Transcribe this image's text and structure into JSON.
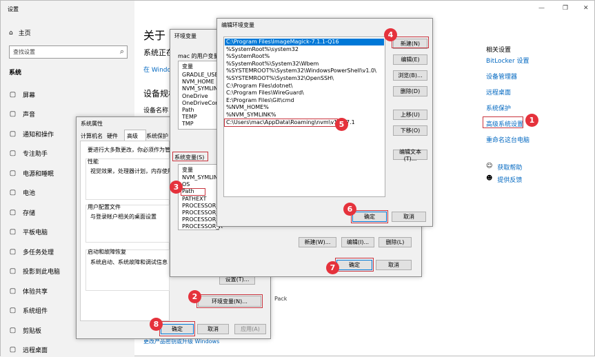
{
  "settings": {
    "title": "设置",
    "home": "主页",
    "search_placeholder": "查找设置",
    "section": "系统",
    "nav": [
      {
        "label": "屏幕",
        "icon": "monitor-icon"
      },
      {
        "label": "声音",
        "icon": "speaker-icon"
      },
      {
        "label": "通知和操作",
        "icon": "notification-icon"
      },
      {
        "label": "专注助手",
        "icon": "moon-icon"
      },
      {
        "label": "电源和睡眠",
        "icon": "power-icon"
      },
      {
        "label": "电池",
        "icon": "battery-icon"
      },
      {
        "label": "存储",
        "icon": "storage-icon"
      },
      {
        "label": "平板电脑",
        "icon": "tablet-icon"
      },
      {
        "label": "多任务处理",
        "icon": "multitask-icon"
      },
      {
        "label": "投影到此电脑",
        "icon": "project-icon"
      },
      {
        "label": "体验共享",
        "icon": "share-icon"
      },
      {
        "label": "系统组件",
        "icon": "components-icon"
      },
      {
        "label": "剪贴板",
        "icon": "clipboard-icon"
      },
      {
        "label": "远程桌面",
        "icon": "remote-icon"
      }
    ],
    "main_title": "关于",
    "main_sub1": "系统正在",
    "main_link1": "在 Window",
    "main_sub2": "设备规格",
    "main_sub3": "设备名称",
    "bottom_link": "更改产品密钥或升级 Windows",
    "pack_text": "Pack",
    "related_title": "相关设置",
    "related": [
      "BitLocker 设置",
      "设备管理器",
      "远程桌面",
      "系统保护",
      "高级系统设置",
      "重命名这台电脑"
    ],
    "help": "获取帮助",
    "feedback": "提供反馈"
  },
  "sysprops": {
    "title": "系统属性",
    "tabs": [
      "计算机名",
      "硬件",
      "高级",
      "系统保护"
    ],
    "admin_note": "要进行大多数更改，你必须作为管理员",
    "perf_label": "性能",
    "perf_desc": "视觉效果，处理器计划，内存使用，",
    "profile_label": "用户配置文件",
    "profile_desc": "与登录帐户相关的桌面设置",
    "startup_label": "启动和故障恢复",
    "startup_desc": "系统启动、系统故障和调试信息",
    "settings_btn": "设置(T)...",
    "env_btn": "环境变量(N)...",
    "ok": "确定",
    "cancel": "取消",
    "apply": "应用(A)"
  },
  "envvars": {
    "title": "环境变量",
    "user_label": "mac 的用户变量(U)",
    "col_var": "变量",
    "user_vars": [
      "GRADLE_USER",
      "NVM_HOME",
      "NVM_SYMLINK",
      "OneDrive",
      "OneDriveConsu",
      "Path",
      "TEMP",
      "TMP"
    ],
    "sys_label": "系统变量(S)",
    "sys_vars": [
      "NVM_SYMLINK",
      "OS",
      "Path",
      "PATHEXT",
      "PROCESSOR_A",
      "PROCESSOR_ID",
      "PROCESSOR_L",
      "PROCESSOR_R"
    ],
    "new": "新建(W)...",
    "edit": "编辑(I)...",
    "delete": "删除(L)",
    "ok": "确定",
    "cancel": "取消"
  },
  "editenv": {
    "title": "编辑环境变量",
    "paths": [
      "C:\\Program Files\\ImageMagick-7.1.1-Q16",
      "%SystemRoot%\\system32",
      "%SystemRoot%",
      "%SystemRoot%\\System32\\Wbem",
      "%SYSTEMROOT%\\System32\\WindowsPowerShell\\v1.0\\",
      "%SYSTEMROOT%\\System32\\OpenSSH\\",
      "C:\\Program Files\\dotnet\\",
      "C:\\Program Files\\WireGuard\\",
      "E:\\Program Files\\Git\\cmd",
      "%NVM_HOME%",
      "%NVM_SYMLINK%",
      "C:\\Users\\mac\\AppData\\Roaming\\nvm\\v18.17.1"
    ],
    "new": "新建(N)",
    "edit": "编辑(E)",
    "browse": "浏览(B)...",
    "delete": "删除(D)",
    "up": "上移(U)",
    "down": "下移(O)",
    "edit_text": "编辑文本(T)...",
    "ok": "确定",
    "cancel": "取消"
  },
  "badges": [
    "1",
    "2",
    "3",
    "4",
    "5",
    "6",
    "7",
    "8"
  ],
  "colors": {
    "accent": "#0067c0",
    "badge": "#e5323c",
    "highlight": "#0078d7"
  }
}
